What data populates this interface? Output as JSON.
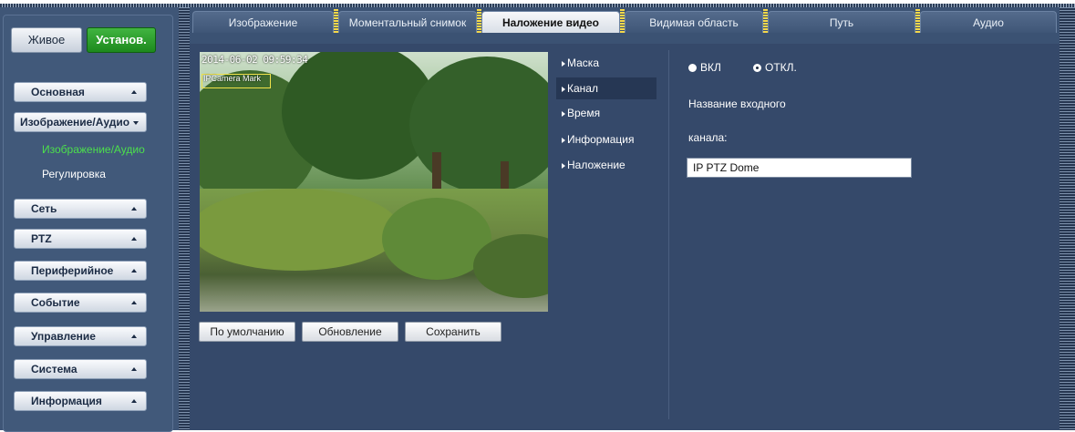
{
  "mode": {
    "live_label": "Живое",
    "setup_label": "Установ."
  },
  "sidebar": {
    "menus": [
      {
        "label": "Основная"
      },
      {
        "label": "Изображение/Аудио"
      },
      {
        "label": "Сеть"
      },
      {
        "label": "PTZ"
      },
      {
        "label": "Периферийное"
      },
      {
        "label": "Событие"
      },
      {
        "label": "Управление"
      },
      {
        "label": "Система"
      },
      {
        "label": "Информация"
      }
    ],
    "subitems": [
      {
        "label": "Изображение/Аудио",
        "active": true
      },
      {
        "label": "Регулировка",
        "active": false
      }
    ]
  },
  "tabs": [
    {
      "label": "Изображение"
    },
    {
      "label": "Моментальный снимок"
    },
    {
      "label": "Наложение видео",
      "active": true
    },
    {
      "label": "Видимая область"
    },
    {
      "label": "Путь"
    },
    {
      "label": "Аудио"
    }
  ],
  "video": {
    "timestamp": "2014-06-02 09:59:34",
    "channel_overlay": "IPCamera Mark"
  },
  "buttons": {
    "default": "По умолчанию",
    "refresh": "Обновление",
    "save": "Сохранить"
  },
  "submenu": [
    {
      "label": "Маска"
    },
    {
      "label": "Канал",
      "active": true
    },
    {
      "label": "Время"
    },
    {
      "label": "Информация"
    },
    {
      "label": "Наложение"
    }
  ],
  "settings": {
    "radio_on": "ВКЛ",
    "radio_off": "ОТКЛ.",
    "selected": "off",
    "channel_name_label_1": "Название входного",
    "channel_name_label_2": "канала:",
    "channel_name_value": "IP PTZ Dome"
  },
  "colors": {
    "background": "#3b5273",
    "active_green": "#4ce04c",
    "setup_button": "#2a9e2a",
    "osd_box": "#f0e24a"
  }
}
